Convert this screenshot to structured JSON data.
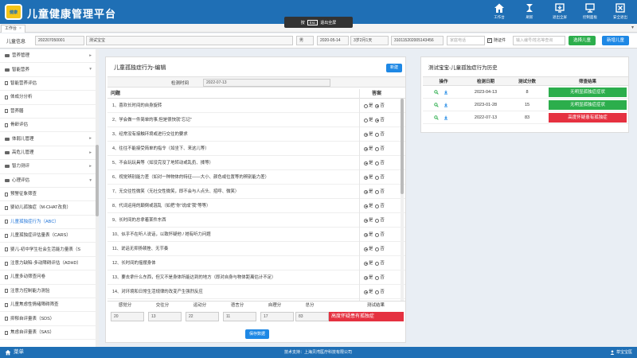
{
  "app": {
    "title": "儿童健康管理平台",
    "logo_text": "健康",
    "top_actions": [
      {
        "label": "工作台",
        "icon": "home-icon"
      },
      {
        "label": "刷新",
        "icon": "refresh-icon"
      },
      {
        "label": "退出全屏",
        "icon": "exit-fullscreen-icon"
      },
      {
        "label": "控制面板",
        "icon": "control-panel-icon"
      },
      {
        "label": "安全退出",
        "icon": "close-icon"
      }
    ]
  },
  "toast": {
    "prefix": "按",
    "key": "Esc",
    "suffix": "退出全屏"
  },
  "tabs": [
    {
      "label": "工作台",
      "close": "×"
    }
  ],
  "tab_arrow": "▾",
  "patient": {
    "label": "儿童信息",
    "id": "202207050001",
    "name": "测试宝宝",
    "gender": "男",
    "birth_date": "2020-05-14",
    "age": "3岁2月1天",
    "id_card": "310115202005143456",
    "phone_placeholder": "家庭电话",
    "certificate_label": "随证件",
    "search_placeholder": "输入编号/姓名等查询",
    "select_button": "选择儿童",
    "add_button": "新增儿童"
  },
  "sidebar": {
    "items": [
      {
        "label": "营养管理",
        "type": "folder",
        "caret": "▸"
      },
      {
        "label": "智能营养",
        "type": "folder",
        "caret": "▾"
      },
      {
        "label": "智能营养评估",
        "type": "doc",
        "caret": ""
      },
      {
        "label": "体成分分析",
        "type": "doc",
        "caret": ""
      },
      {
        "label": "营养膳",
        "type": "doc",
        "caret": ""
      },
      {
        "label": "骨龄评估",
        "type": "doc",
        "caret": ""
      },
      {
        "label": "体弱儿管理",
        "type": "folder",
        "caret": "▸"
      },
      {
        "label": "高危儿管理",
        "type": "folder",
        "caret": "▸"
      },
      {
        "label": "智力测评",
        "type": "folder",
        "caret": "▸"
      },
      {
        "label": "心理评估",
        "type": "folder",
        "caret": "▾"
      },
      {
        "label": "预警征象筛查",
        "type": "doc",
        "caret": ""
      },
      {
        "label": "婴幼儿孤独症（M-CHAT改良）",
        "type": "doc",
        "caret": ""
      },
      {
        "label": "儿童孤独症行为（ABC）",
        "type": "doc",
        "caret": ""
      },
      {
        "label": "儿童孤独症评估量表（CARS）",
        "type": "doc",
        "caret": ""
      },
      {
        "label": "婴儿-初中学生社会生活能力量表（S",
        "type": "doc",
        "caret": ""
      },
      {
        "label": "注意力缺陷-多动障碍评估（ADHD）",
        "type": "doc",
        "caret": ""
      },
      {
        "label": "儿童多动筛查问卷",
        "type": "doc",
        "caret": ""
      },
      {
        "label": "注意力控制能力测验",
        "type": "doc",
        "caret": ""
      },
      {
        "label": "儿童焦虑性情绪障碍筛查",
        "type": "doc",
        "caret": ""
      },
      {
        "label": "抑郁自评量表（SDS）",
        "type": "doc",
        "caret": ""
      },
      {
        "label": "焦虑自评量表（SAS）",
        "type": "doc",
        "caret": ""
      }
    ]
  },
  "form": {
    "title": "儿童孤独症行为-编辑",
    "new_button": "新建",
    "date_label": "检测时间",
    "date_value": "2022-07-13",
    "col_question": "问题",
    "col_answer": "答案",
    "opt_yes": "是",
    "opt_no": "否",
    "questions": [
      {
        "text": "1、喜欢长时间的自身旋转",
        "answer": "否"
      },
      {
        "text": "2、学会做一件简单的事,但是很快就“忘记”",
        "answer": "否"
      },
      {
        "text": "3、经常没有接触环境或进行交往的要求",
        "answer": "是"
      },
      {
        "text": "4、往往不能接受简单的指令（如坐下、来这儿等）",
        "answer": "是"
      },
      {
        "text": "5、不会玩玩具等（如没完没了地转动或乱扔、揉等）",
        "answer": "是"
      },
      {
        "text": "6、视觉辨别能力差（如对一种物体的特征——大小、颜色或位置等的辨别能力差）",
        "answer": "是"
      },
      {
        "text": "7、无交往性微笑（无社交性微笑，即不会与人点头、招呼、微笑）",
        "answer": "是"
      },
      {
        "text": "8、代词运用的颠倒或混乱（如把“你”说成“我”等等）",
        "answer": "是"
      },
      {
        "text": "9、长时间的总拿着某件东西",
        "answer": "是"
      },
      {
        "text": "10、似乎不在听人说话，以致怀疑他 / 她有听力问题",
        "answer": "是"
      },
      {
        "text": "11、说话无抑扬顿挫、无节奏",
        "answer": "是"
      },
      {
        "text": "12、长时间的摇摆身体",
        "answer": "是"
      },
      {
        "text": "13、要去拿什么东西，但又不是身体所能达到的地方（即对自身与物体距离估计不足）",
        "answer": "是"
      },
      {
        "text": "14、对环境和日常生活规律的改变产生强烈反应",
        "answer": "是"
      }
    ],
    "score_headers": [
      "感觉分",
      "交往分",
      "运动分",
      "语言分",
      "自理分",
      "总分",
      "测试结果"
    ],
    "score_values": [
      "20",
      "13",
      "22",
      "11",
      "17",
      "83"
    ],
    "result": "高度怀疑患有孤独症",
    "save_button": "保存数据"
  },
  "history": {
    "title": "测试宝宝-儿童孤独症行为历史",
    "headers": [
      "操作",
      "检测日期",
      "测试分数",
      "筛查结果"
    ],
    "rows": [
      {
        "date": "2023-04-13",
        "score": "8",
        "result": "无明显孤独症症状",
        "status": "normal"
      },
      {
        "date": "2023-01-28",
        "score": "15",
        "result": "无明显孤独症症状",
        "status": "normal"
      },
      {
        "date": "2022-07-13",
        "score": "83",
        "result": "高度怀疑患有孤独症",
        "status": "alert"
      }
    ]
  },
  "footer": {
    "menu_label": "菜单",
    "support": "技术支持：上海贝湾医疗科技有限公司",
    "user": "草宝宝医"
  },
  "colors": {
    "brand": "#1f6fb5",
    "ok": "#2cae4c",
    "alert": "#e53140",
    "link": "#1e73d8"
  }
}
